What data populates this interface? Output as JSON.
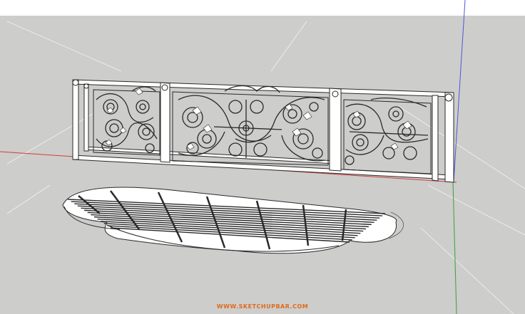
{
  "app": {
    "name": "SketchUp viewport",
    "background_top": "#ffffff",
    "background_ground": "#cdcdcb"
  },
  "axes": {
    "red_color": "#d23c3c",
    "green_color": "#3aa03a",
    "blue_color": "#4a5ad8"
  },
  "model": {
    "railing_label": "wrought iron railing",
    "grate_label": "curved floor grate",
    "line_color": "#2a2a2a",
    "fill_color": "#ffffff"
  },
  "watermark": {
    "text": "WWW.SKETCHUPBAR.COM",
    "color": "#e06a1c"
  }
}
